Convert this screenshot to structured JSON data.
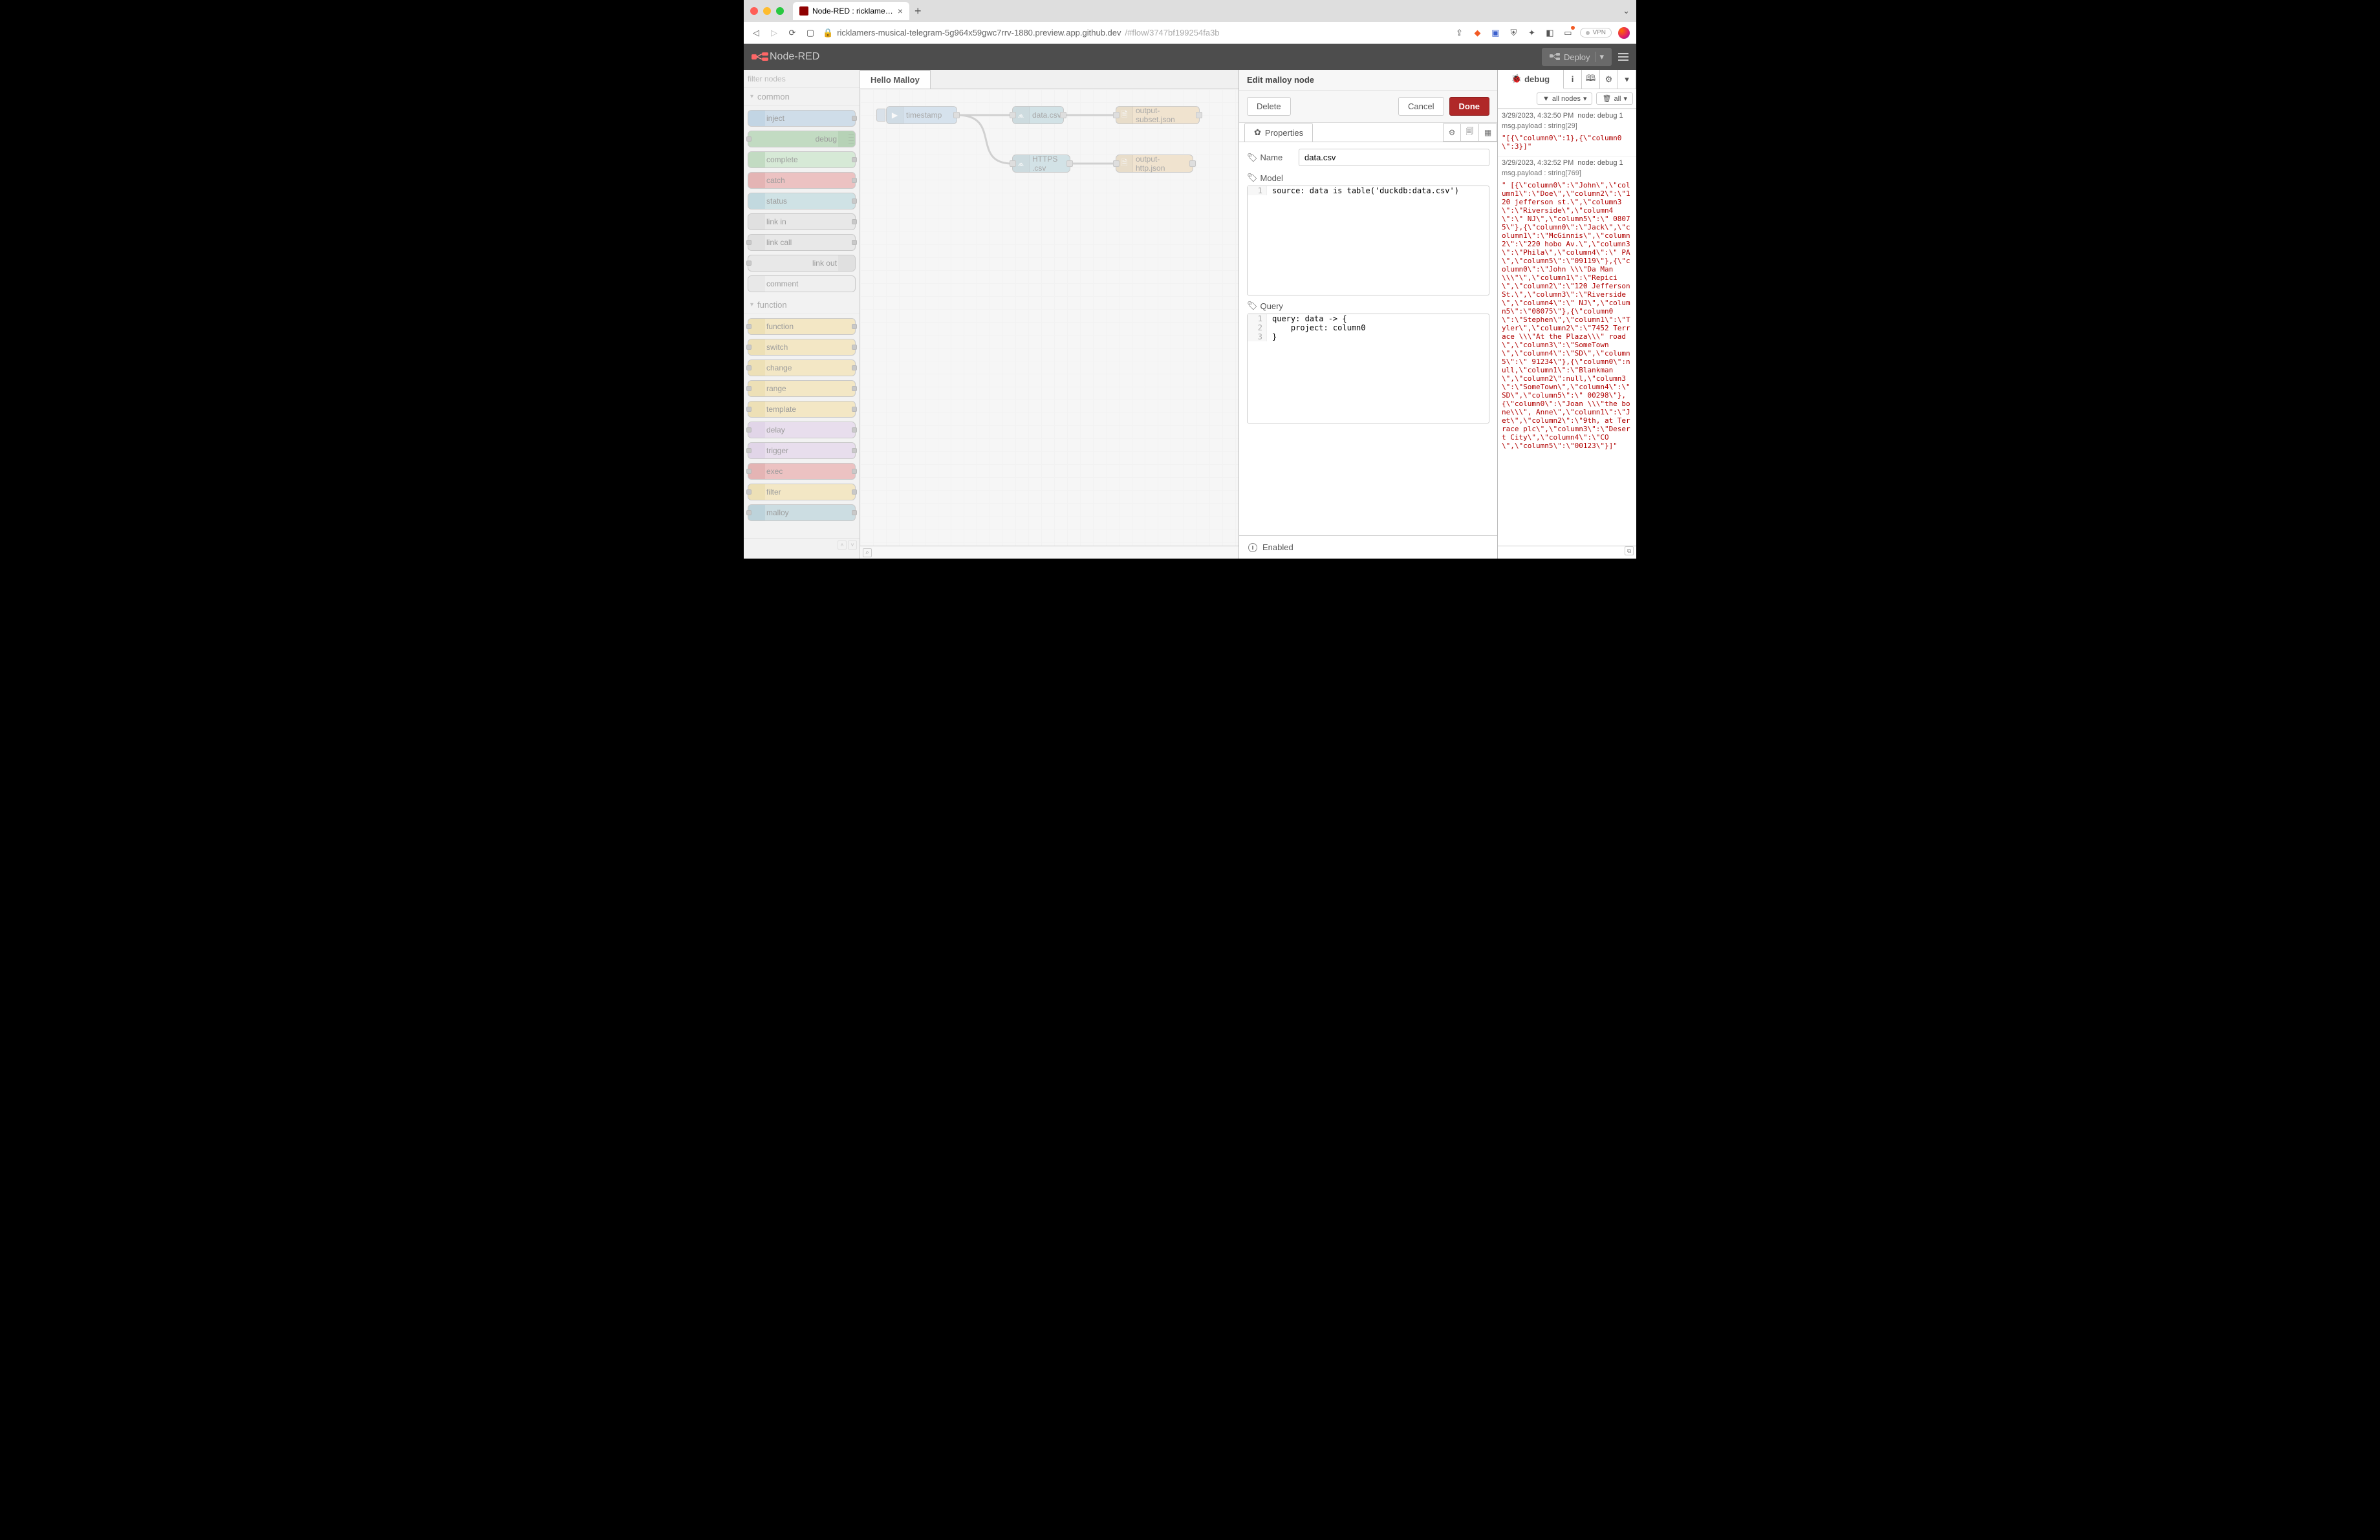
{
  "browser": {
    "tab_title": "Node-RED : ricklamers-musical...",
    "url_host": "ricklamers-musical-telegram-5g964x59gwc7rrv-1880.preview.app.github.dev",
    "url_path": "/#flow/3747bf199254fa3b",
    "vpn_label": "VPN"
  },
  "header": {
    "brand": "Node-RED",
    "deploy": "Deploy"
  },
  "palette": {
    "filter_placeholder": "filter nodes",
    "cats": [
      {
        "label": "common",
        "items": [
          {
            "label": "inject",
            "cls": "c-inject",
            "side": "left",
            "pl": false,
            "pr": true
          },
          {
            "label": "debug",
            "cls": "c-debug",
            "side": "right",
            "pl": true,
            "pr": false,
            "bars": true
          },
          {
            "label": "complete",
            "cls": "c-complete",
            "side": "left",
            "pl": false,
            "pr": true
          },
          {
            "label": "catch",
            "cls": "c-catch",
            "side": "left",
            "pl": false,
            "pr": true
          },
          {
            "label": "status",
            "cls": "c-status",
            "side": "left",
            "pl": false,
            "pr": true
          },
          {
            "label": "link in",
            "cls": "c-link",
            "side": "left",
            "pl": false,
            "pr": true
          },
          {
            "label": "link call",
            "cls": "c-link",
            "side": "left",
            "pl": true,
            "pr": true
          },
          {
            "label": "link out",
            "cls": "c-link",
            "side": "right",
            "pl": true,
            "pr": false
          },
          {
            "label": "comment",
            "cls": "c-comment",
            "side": "left",
            "pl": false,
            "pr": false
          }
        ]
      },
      {
        "label": "function",
        "items": [
          {
            "label": "function",
            "cls": "c-function",
            "side": "left",
            "pl": true,
            "pr": true
          },
          {
            "label": "switch",
            "cls": "c-switch",
            "side": "left",
            "pl": true,
            "pr": true
          },
          {
            "label": "change",
            "cls": "c-change",
            "side": "left",
            "pl": true,
            "pr": true
          },
          {
            "label": "range",
            "cls": "c-range",
            "side": "left",
            "pl": true,
            "pr": true
          },
          {
            "label": "template",
            "cls": "c-template",
            "side": "left",
            "pl": true,
            "pr": true
          },
          {
            "label": "delay",
            "cls": "c-delay",
            "side": "left",
            "pl": true,
            "pr": true
          },
          {
            "label": "trigger",
            "cls": "c-trigger",
            "side": "left",
            "pl": true,
            "pr": true
          },
          {
            "label": "exec",
            "cls": "c-exec",
            "side": "left",
            "pl": true,
            "pr": true
          },
          {
            "label": "filter",
            "cls": "c-filter",
            "side": "left",
            "pl": true,
            "pr": true
          },
          {
            "label": "malloy",
            "cls": "c-malloy",
            "side": "left",
            "pl": true,
            "pr": true
          }
        ]
      }
    ]
  },
  "workspace": {
    "tab": "Hello Malloy",
    "nodes": {
      "timestamp": "timestamp",
      "datacsv": "data.csv",
      "httpscsv": "HTTPS .csv",
      "outsubset": "output-subset.json",
      "outhttp": "output-http.json"
    }
  },
  "tray": {
    "title": "Edit malloy node",
    "delete": "Delete",
    "cancel": "Cancel",
    "done": "Done",
    "properties": "Properties",
    "name_label": "Name",
    "name_value": "data.csv",
    "model_label": "Model",
    "model_lines": [
      "source: data is table('duckdb:data.csv')"
    ],
    "query_label": "Query",
    "query_lines": [
      "query: data -> {",
      "    project: column0",
      "}"
    ],
    "enabled": "Enabled"
  },
  "sidebar": {
    "tab": "debug",
    "filter_all_nodes": "all nodes",
    "clear_all": "all",
    "messages": [
      {
        "time": "3/29/2023, 4:32:50 PM",
        "node": "node: debug 1",
        "payload_label": "msg.payload : string[29]",
        "content": "\"[{\\\"column0\\\":1},{\\\"column0\\\":3}]\""
      },
      {
        "time": "3/29/2023, 4:32:52 PM",
        "node": "node: debug 1",
        "payload_label": "msg.payload : string[769]",
        "content": "\"\n[{\\\"column0\\\":\\\"John\\\",\\\"column1\\\":\\\"Doe\\\",\\\"column2\\\":\\\"120 jefferson st.\\\",\\\"column3\\\":\\\"Riverside\\\",\\\"column4\\\":\\\" NJ\\\",\\\"column5\\\":\\\" 08075\\\"},{\\\"column0\\\":\\\"Jack\\\",\\\"column1\\\":\\\"McGinnis\\\",\\\"column2\\\":\\\"220 hobo Av.\\\",\\\"column3\\\":\\\"Phila\\\",\\\"column4\\\":\\\" PA\\\",\\\"column5\\\":\\\"09119\\\"},{\\\"column0\\\":\\\"John \\\\\\\"Da Man\\\\\\\"\\\",\\\"column1\\\":\\\"Repici\\\",\\\"column2\\\":\\\"120 Jefferson St.\\\",\\\"column3\\\":\\\"Riverside\\\",\\\"column4\\\":\\\" NJ\\\",\\\"column5\\\":\\\"08075\\\"},{\\\"column0\\\":\\\"Stephen\\\",\\\"column1\\\":\\\"Tyler\\\",\\\"column2\\\":\\\"7452 Terrace \\\\\\\"At the Plaza\\\\\\\" road\\\",\\\"column3\\\":\\\"SomeTown\\\",\\\"column4\\\":\\\"SD\\\",\\\"column5\\\":\\\" 91234\\\"},{\\\"column0\\\":null,\\\"column1\\\":\\\"Blankman\\\",\\\"column2\\\":null,\\\"column3\\\":\\\"SomeTown\\\",\\\"column4\\\":\\\" SD\\\",\\\"column5\\\":\\\" 00298\\\"},{\\\"column0\\\":\\\"Joan \\\\\\\"the bone\\\\\\\", Anne\\\",\\\"column1\\\":\\\"Jet\\\",\\\"column2\\\":\\\"9th, at Terrace plc\\\",\\\"column3\\\":\\\"Desert City\\\",\\\"column4\\\":\\\"CO\\\",\\\"column5\\\":\\\"00123\\\"}]\""
      }
    ]
  }
}
